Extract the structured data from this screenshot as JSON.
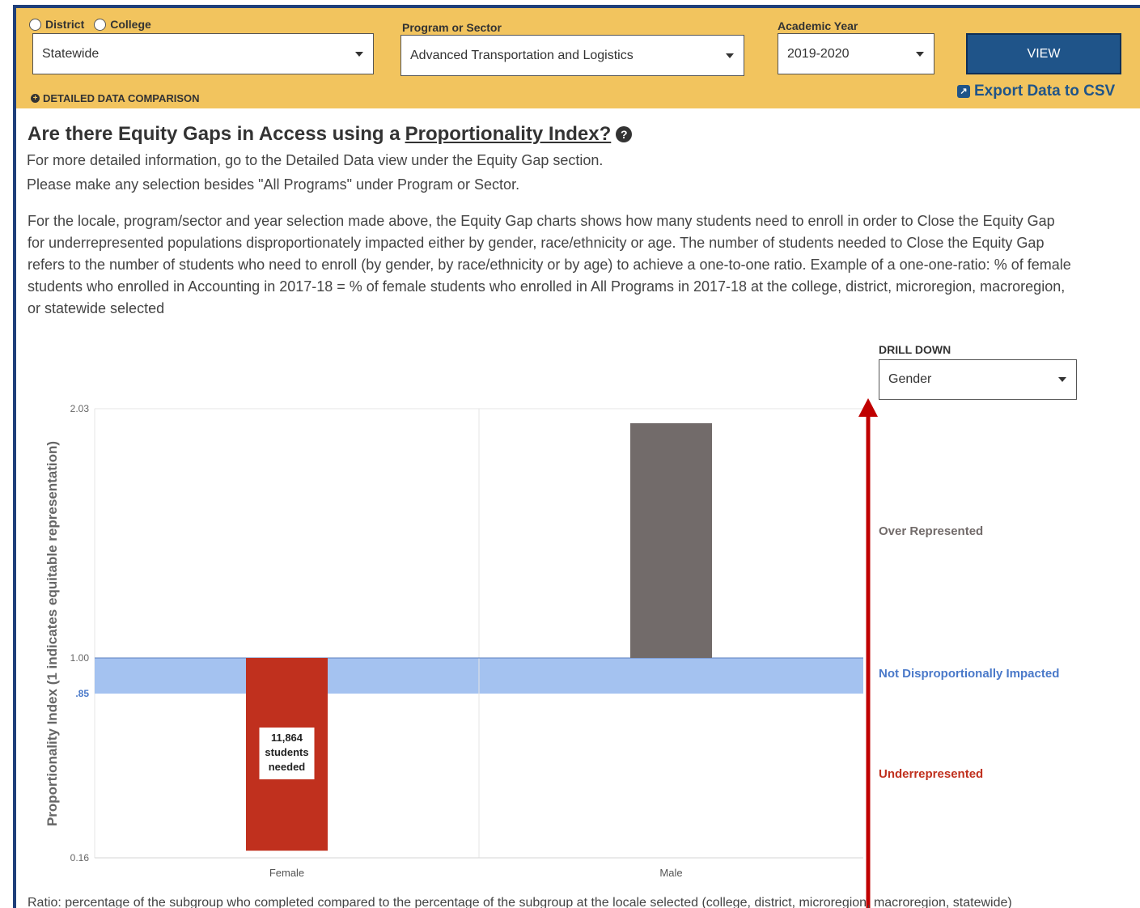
{
  "filters": {
    "radio_options": [
      "District",
      "College"
    ],
    "locale_value": "Statewide",
    "program_label": "Program or Sector",
    "program_value": "Advanced Transportation and Logistics",
    "year_label": "Academic Year",
    "year_value": "2019-2020",
    "view_label": "VIEW",
    "detailed_comparison": "DETAILED DATA COMPARISON",
    "export_label": "Export Data to CSV"
  },
  "content": {
    "title_prefix": "Are there Equity Gaps in Access using a ",
    "title_link": "Proportionality Index?",
    "line1": "For more detailed information, go to the Detailed Data view under the Equity Gap section.",
    "line2": "Please make any selection besides \"All Programs\" under Program or Sector.",
    "paragraph": "For the locale, program/sector and year selection made above, the Equity Gap charts shows how many students need to enroll in order to Close the Equity Gap for underrepresented populations disproportionately impacted either by gender, race/ethnicity or age. The number of students needed to Close the Equity Gap refers to the number of students who need to enroll (by gender, by race/ethnicity or by age) to achieve a one-to-one ratio. Example of a one-one-ratio: % of female students who enrolled in Accounting in 2017-18 = % of female students who enrolled in All Programs in 2017-18 at the college, district, microregion, macroregion, or statewide selected",
    "ratio_note": "Ratio: percentage of the subgroup who completed compared to the percentage of the subgroup at the locale selected (college, district, microregion, macroregion, statewide)"
  },
  "drill_down": {
    "label": "DRILL DOWN",
    "value": "Gender"
  },
  "colors": {
    "header_bg": "#f2c45e",
    "under": "#c0301e",
    "over": "#726b6a",
    "band": "#a4c2f0",
    "band_text": "#4a79c9",
    "arrow": "#c00000"
  },
  "chart_data": {
    "type": "bar",
    "categories": [
      "Female",
      "Male"
    ],
    "values": [
      0.19,
      1.97
    ],
    "ylabel": "Proportionality Index (1 indicates equitable representation)",
    "ylim": [
      0.16,
      2.03
    ],
    "y_ticks": [
      "2.03",
      "1.00",
      ".85",
      "0.16"
    ],
    "baseline": 1.0,
    "band": [
      0.85,
      1.0
    ],
    "bar_labels": [
      "11,864\nstudents\nneeded",
      ""
    ],
    "zones": [
      "Over Represented",
      "Not Disproportionally Impacted",
      "Underrepresented"
    ]
  }
}
